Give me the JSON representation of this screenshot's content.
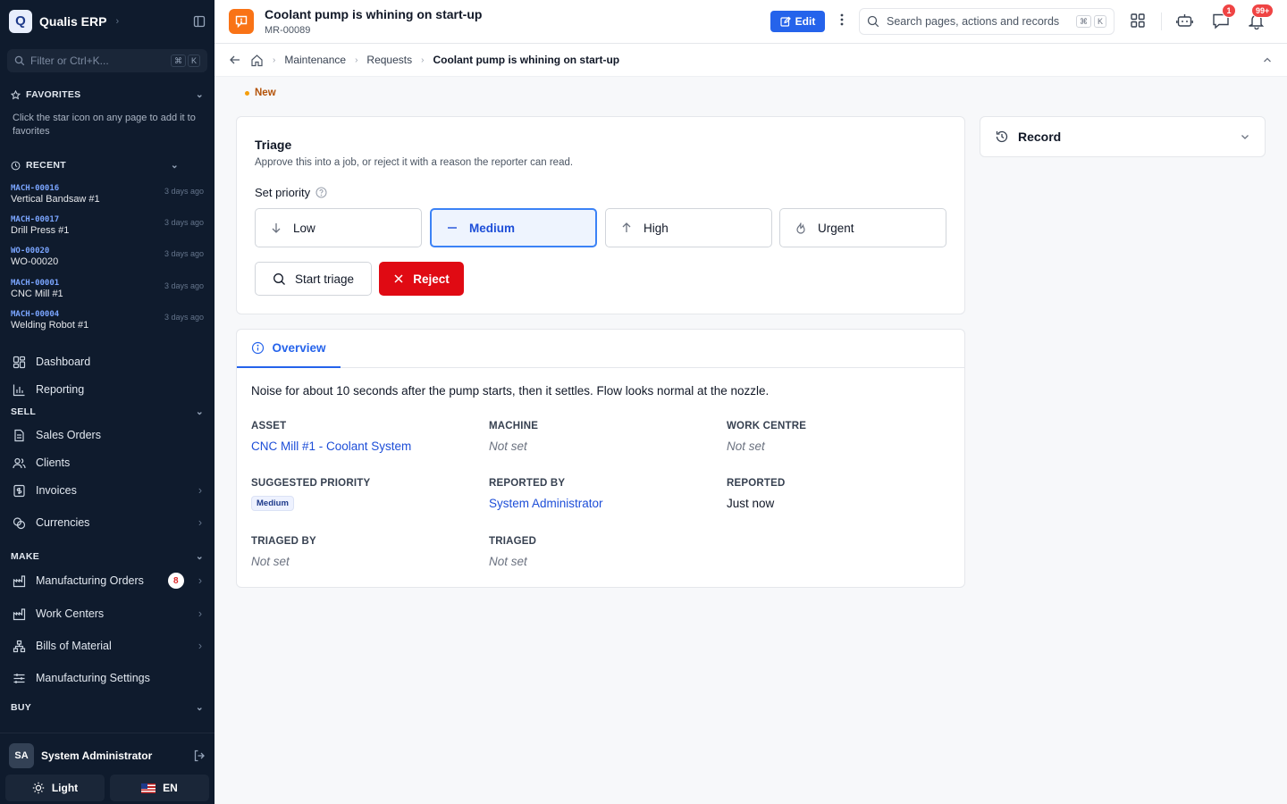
{
  "app": {
    "name": "Qualis ERP",
    "logo_letter": "Q"
  },
  "sidebar": {
    "filter_placeholder": "Filter or Ctrl+K...",
    "filter_keys": [
      "⌘",
      "K"
    ],
    "favorites": {
      "title": "FAVORITES",
      "empty_text": "Click the star icon on any page to add it to favorites"
    },
    "recent": {
      "title": "RECENT",
      "items": [
        {
          "code": "MACH-00016",
          "name": "Vertical Bandsaw #1",
          "time": "3 days ago"
        },
        {
          "code": "MACH-00017",
          "name": "Drill Press #1",
          "time": "3 days ago"
        },
        {
          "code": "WO-00020",
          "name": "WO-00020",
          "time": "3 days ago"
        },
        {
          "code": "MACH-00001",
          "name": "CNC Mill #1",
          "time": "3 days ago"
        },
        {
          "code": "MACH-00004",
          "name": "Welding Robot #1",
          "time": "3 days ago"
        }
      ]
    },
    "nav": {
      "dashboard": "Dashboard",
      "reporting": "Reporting",
      "sell_title": "SELL",
      "sales_orders": "Sales Orders",
      "clients": "Clients",
      "invoices": "Invoices",
      "currencies": "Currencies",
      "make_title": "MAKE",
      "manufacturing_orders": "Manufacturing Orders",
      "manufacturing_orders_badge": "8",
      "work_centers": "Work Centers",
      "bills_of_material": "Bills of Material",
      "manufacturing_settings": "Manufacturing Settings",
      "buy_title": "BUY"
    },
    "user": {
      "initials": "SA",
      "name": "System Administrator"
    },
    "theme_label": "Light",
    "lang_label": "EN"
  },
  "topbar": {
    "title": "Coolant pump is whining on start-up",
    "record_id": "MR-00089",
    "edit_label": "Edit",
    "search_placeholder": "Search pages, actions and records",
    "search_keys": [
      "⌘",
      "K"
    ],
    "messages_badge": "1",
    "notifications_badge": "99+"
  },
  "breadcrumb": [
    "Maintenance",
    "Requests",
    "Coolant pump is whining on start-up"
  ],
  "status": "New",
  "triage": {
    "title": "Triage",
    "description": "Approve this into a job, or reject it with a reason the reporter can read.",
    "priority_label": "Set priority",
    "priorities": [
      "Low",
      "Medium",
      "High",
      "Urgent"
    ],
    "selected_priority": "Medium",
    "start_label": "Start triage",
    "reject_label": "Reject"
  },
  "record_panel": {
    "title": "Record"
  },
  "overview": {
    "tab_label": "Overview",
    "description": "Noise for about 10 seconds after the pump starts, then it settles. Flow looks normal at the nozzle.",
    "fields": {
      "asset": {
        "label": "ASSET",
        "value": "CNC Mill #1 - Coolant System"
      },
      "machine": {
        "label": "MACHINE",
        "value": "Not set"
      },
      "work_centre": {
        "label": "WORK CENTRE",
        "value": "Not set"
      },
      "suggested_priority": {
        "label": "SUGGESTED PRIORITY",
        "value": "Medium"
      },
      "reported_by": {
        "label": "REPORTED BY",
        "value": "System Administrator"
      },
      "reported": {
        "label": "REPORTED",
        "value": "Just now"
      },
      "triaged_by": {
        "label": "TRIAGED BY",
        "value": "Not set"
      },
      "triaged": {
        "label": "TRIAGED",
        "value": "Not set"
      }
    }
  },
  "colors": {
    "accent": "#2563eb",
    "danger": "#e00a13",
    "sidebar_bg": "#0f1b2d",
    "status": "#f59e0b",
    "request_icon": "#f97316"
  }
}
